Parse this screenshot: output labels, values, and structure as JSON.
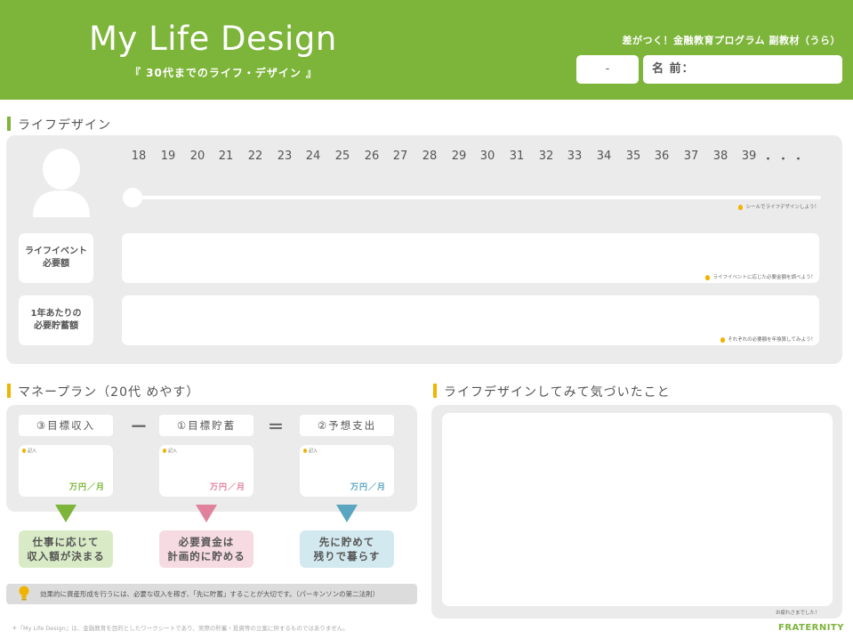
{
  "header": {
    "title": "My Life Design",
    "subtitle": "『 30代までのライフ・デザイン 』",
    "program": "差がつく！金融教育プログラム 副教材（うら）",
    "class_value": "-",
    "name_label": "名 前："
  },
  "life_design": {
    "heading": "ライフデザイン",
    "ages": [
      "18",
      "19",
      "20",
      "21",
      "22",
      "23",
      "24",
      "25",
      "26",
      "27",
      "28",
      "29",
      "30",
      "31",
      "32",
      "33",
      "34",
      "35",
      "36",
      "37",
      "38",
      "39",
      "・・・"
    ],
    "timeline_hint": "シールでライフデザインしよう！",
    "row1_label_line1": "ライフイベント",
    "row1_label_line2": "必要額",
    "row1_hint": "ライフイベントに応じた必要金額を調べよう！",
    "row2_label_line1": "1年あたりの",
    "row2_label_line2": "必要貯蓄額",
    "row2_hint": "それぞれの必要額を年換算してみよう！"
  },
  "money_plan": {
    "heading": "マネープラン（20代 めやす）",
    "minus": "ー",
    "equals": "＝",
    "items": [
      {
        "tag": "③目標収入",
        "small": "記入",
        "unit": "万円／月",
        "color": "#7db43a",
        "result_line1": "仕事に応じて",
        "result_line2": "収入額が決まる",
        "result_bg": "#d9ebc6"
      },
      {
        "tag": "①目標貯蓄",
        "small": "記入",
        "unit": "万円／月",
        "color": "#e0829c",
        "result_line1": "必要資金は",
        "result_line2": "計画的に貯める",
        "result_bg": "#f6dbe3"
      },
      {
        "tag": "②予想支出",
        "small": "記入",
        "unit": "万円／月",
        "color": "#5aa5bf",
        "result_line1": "先に貯めて",
        "result_line2": "残りで暮らす",
        "result_bg": "#d3e9f0"
      }
    ],
    "tip": "効果的に資産形成を行うには、必要な収入を稼ぎ、「先に貯蓄」することが大切です。（パーキンソンの第二法則）"
  },
  "notice": {
    "heading": "ライフデザインしてみて気づいたこと",
    "closing": "お疲れさまでした！"
  },
  "footer": {
    "note": "＊『My Life Design』は、金融教育を目的としたワークシートであり、実際の貯蓄・投資等の立案に供するものではありません。",
    "brand": "FRATERNITY"
  }
}
